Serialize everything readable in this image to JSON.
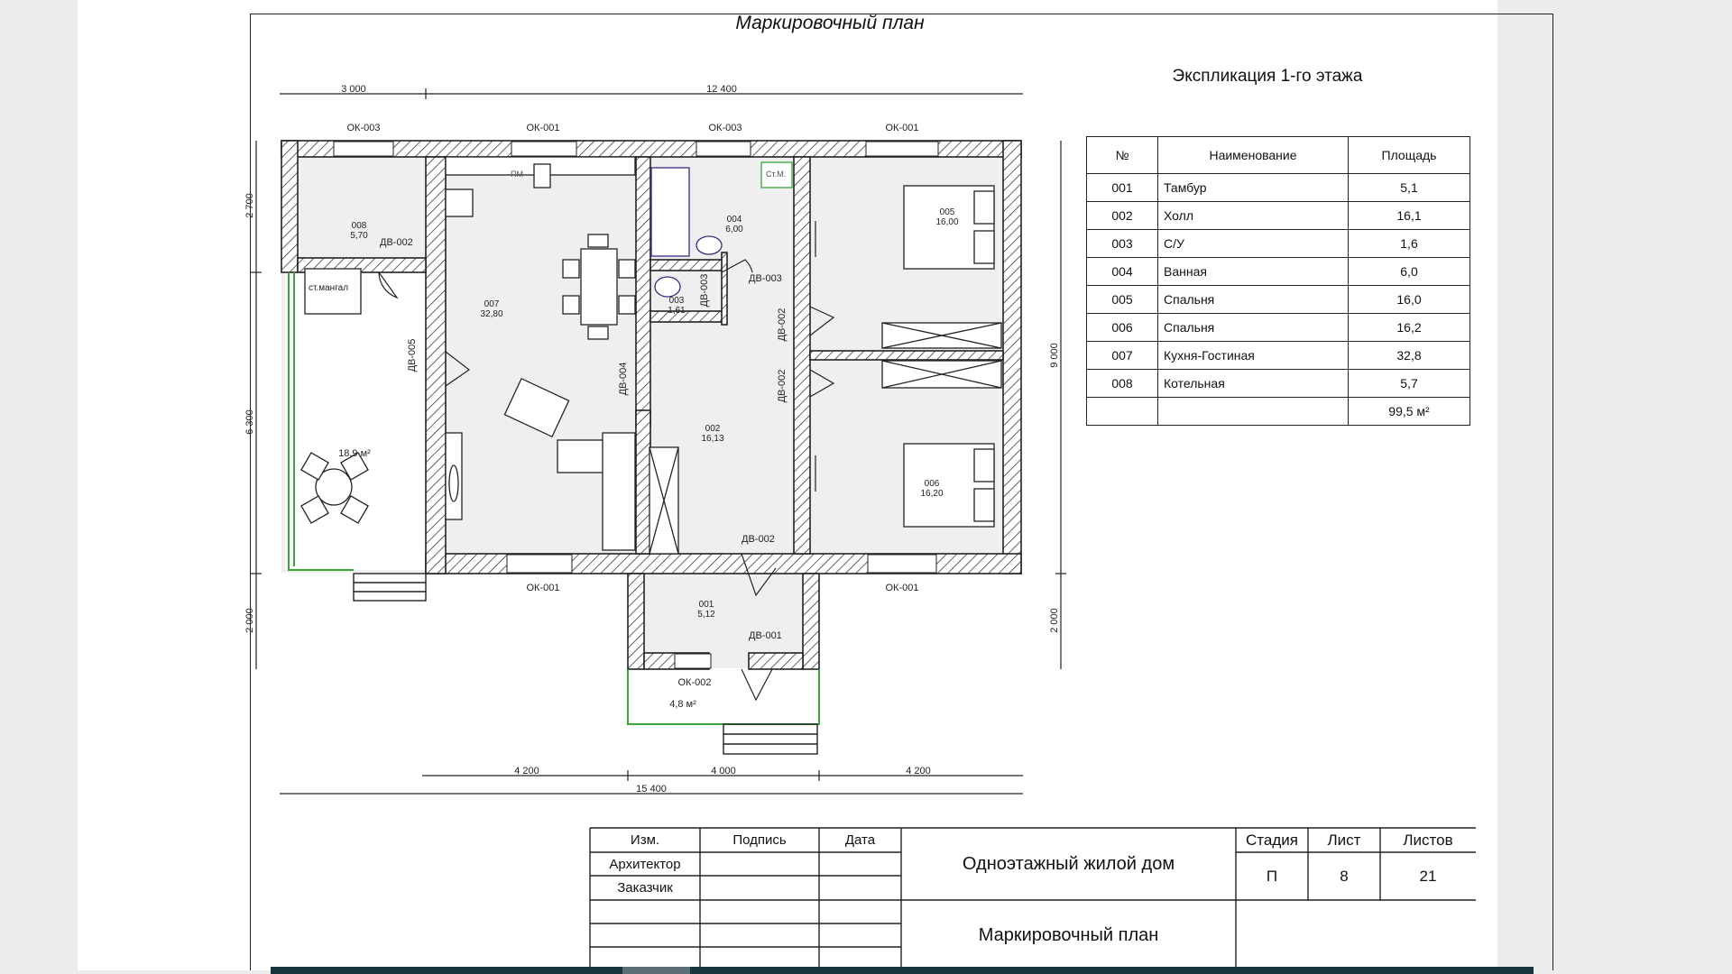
{
  "document": {
    "plan_title": "Маркировочный план",
    "explication_title": "Экспликация 1-го этажа"
  },
  "explication": {
    "headers": {
      "no": "№",
      "name": "Наименование",
      "area": "Площадь"
    },
    "rows": [
      {
        "no": "001",
        "name": "Тамбур",
        "area": "5,1"
      },
      {
        "no": "002",
        "name": "Холл",
        "area": "16,1"
      },
      {
        "no": "003",
        "name": "С/У",
        "area": "1,6"
      },
      {
        "no": "004",
        "name": "Ванная",
        "area": "6,0"
      },
      {
        "no": "005",
        "name": "Спальня",
        "area": "16,0"
      },
      {
        "no": "006",
        "name": "Спальня",
        "area": "16,2"
      },
      {
        "no": "007",
        "name": "Кухня-Гостиная",
        "area": "32,8"
      },
      {
        "no": "008",
        "name": "Котельная",
        "area": "5,7"
      }
    ],
    "total": "99,5 м²"
  },
  "dimensions": {
    "top_left": "3 000",
    "top_right": "12 400",
    "bottom_1": "4 200",
    "bottom_2": "4 000",
    "bottom_3": "4 200",
    "bottom_total": "15 400",
    "left_1": "2 700",
    "left_2": "6 300",
    "left_3": "2 000",
    "right_1": "9 000",
    "right_2": "2 000"
  },
  "rooms": {
    "r001": {
      "num": "001",
      "area": "5,12"
    },
    "r002": {
      "num": "002",
      "area": "16,13"
    },
    "r003": {
      "num": "003",
      "area": "1,61"
    },
    "r004": {
      "num": "004",
      "area": "6,00"
    },
    "r005": {
      "num": "005",
      "area": "16,00"
    },
    "r006": {
      "num": "006",
      "area": "16,20"
    },
    "r007": {
      "num": "007",
      "area": "32,80"
    },
    "r008": {
      "num": "008",
      "area": "5,70"
    },
    "terrace_area": "18,9 м²",
    "porch_area": "4,8 м²"
  },
  "windows": {
    "ok003_a": "ОК-003",
    "ok001_a": "ОК-001",
    "ok003_b": "ОК-003",
    "ok001_b": "ОК-001",
    "ok001_c": "ОК-001",
    "ok001_d": "ОК-001",
    "ok002": "ОК-002"
  },
  "doors": {
    "dv002_a": "ДВ-002",
    "dv003_a": "ДВ-003",
    "dv003_b": "ДВ-003",
    "dv005": "ДВ-005",
    "dv004": "ДВ-004",
    "dv002_b": "ДВ-002",
    "dv002_c": "ДВ-002",
    "dv002_d": "ДВ-002",
    "dv001": "ДВ-001"
  },
  "fixtures": {
    "pm": "ПМ",
    "stm": "Ст.М.",
    "mangal": "ст.мангал"
  },
  "title_block": {
    "izm": "Изм.",
    "podpis": "Подпись",
    "data": "Дата",
    "architect": "Архитектор",
    "customer": "Заказчик",
    "project": "Одноэтажный жилой дом",
    "sheet_title": "Маркировочный план",
    "stage_label": "Стадия",
    "sheet_label": "Лист",
    "sheets_label": "Листов",
    "stage": "П",
    "sheet": "8",
    "sheets": "21"
  }
}
